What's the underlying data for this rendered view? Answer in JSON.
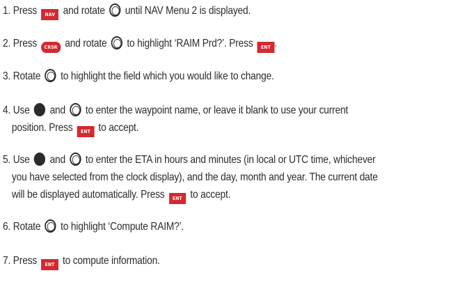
{
  "steps": [
    {
      "num": "1.",
      "parts": [
        "Press",
        "NAV",
        "and rotate",
        "until NAV Menu 2 is displayed."
      ]
    },
    {
      "num": "2.",
      "parts": [
        "Press",
        "CRSR",
        "and rotate",
        "to highlight ‘RAIM Prd?’.  Press",
        "ENT",
        "."
      ]
    },
    {
      "num": "3.",
      "parts": [
        "Rotate",
        "to highlight the field which you would like to change."
      ]
    },
    {
      "num": "4.",
      "parts": [
        "Use",
        "and",
        "to enter the waypoint name, or leave it blank to use your current"
      ],
      "cont": [
        "position. Press",
        "ENT",
        "to accept."
      ]
    },
    {
      "num": "5.",
      "parts": [
        "Use",
        "and",
        "to enter the ETA in hours and minutes (in local or UTC time, whichever"
      ],
      "cont1": "you have selected from the clock display), and the day, month and year. The current date",
      "cont2": [
        "will be displayed automatically. Press",
        "ENT",
        "to accept."
      ]
    },
    {
      "num": "6.",
      "parts": [
        "Rotate",
        "to highlight ‘Compute RAIM?’."
      ]
    },
    {
      "num": "7.",
      "parts": [
        "Press",
        "ENT",
        "to compute information."
      ]
    }
  ],
  "icons": {
    "outer_knob": "outer-knob-icon",
    "inner_knob": "inner-knob-icon"
  },
  "colors": {
    "key_background": "#d6282f",
    "text": "#2b2b2b"
  }
}
